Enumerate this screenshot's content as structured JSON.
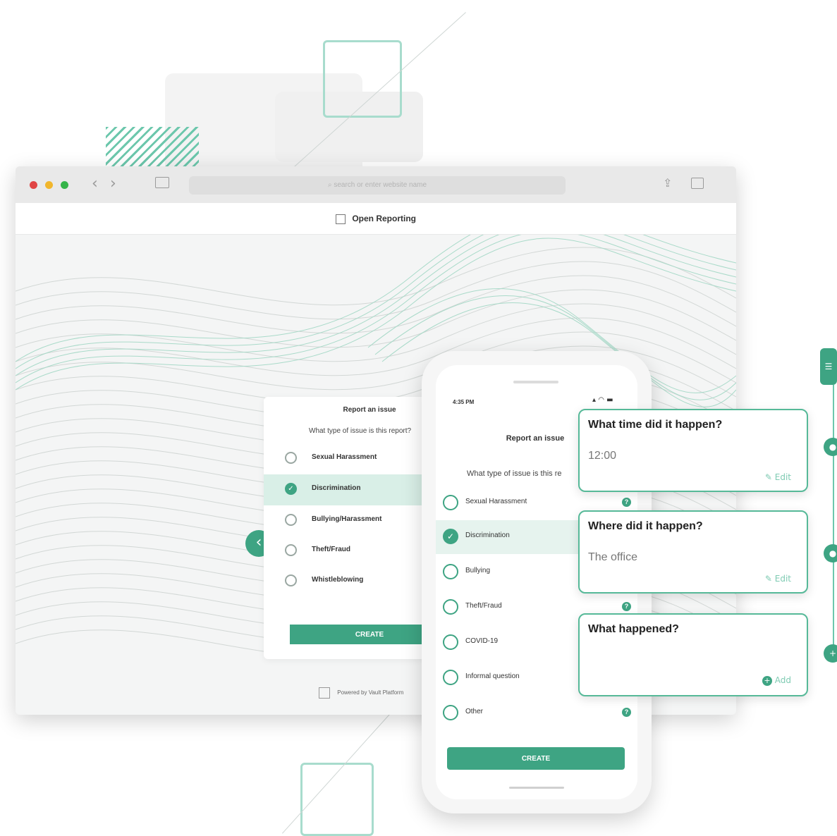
{
  "browser": {
    "address_placeholder": "search or enter website name",
    "page_title": "Open Reporting",
    "back_icon": "chevron-left-icon",
    "footer_text": "Powered by Vault Platform"
  },
  "desktop_form": {
    "title": "Report an issue",
    "question": "What type of issue is this report?",
    "options": [
      {
        "label": "Sexual Harassment",
        "selected": false
      },
      {
        "label": "Discrimination",
        "selected": true
      },
      {
        "label": "Bullying/Harassment",
        "selected": false
      },
      {
        "label": "Theft/Fraud",
        "selected": false
      },
      {
        "label": "Whistleblowing",
        "selected": false
      }
    ],
    "create_label": "CREATE"
  },
  "phone": {
    "status_time": "4:35 PM",
    "status_icons": "signal wifi battery",
    "title": "Report an issue",
    "question": "What type of issue is this re",
    "options": [
      {
        "label": "Sexual Harassment",
        "selected": false,
        "help": true
      },
      {
        "label": "Discrimination",
        "selected": true,
        "help": false
      },
      {
        "label": "Bullying",
        "selected": false,
        "help": false
      },
      {
        "label": "Theft/Fraud",
        "selected": false,
        "help": true
      },
      {
        "label": "COVID-19",
        "selected": false,
        "help": false
      },
      {
        "label": "Informal question",
        "selected": false,
        "help": false
      },
      {
        "label": "Other",
        "selected": false,
        "help": true
      }
    ],
    "create_label": "CREATE"
  },
  "cards": [
    {
      "question": "What time did it happen?",
      "answer": "12:00",
      "action": "Edit"
    },
    {
      "question": "Where did it happen?",
      "answer": "The office",
      "action": "Edit"
    },
    {
      "question": "What happened?",
      "answer": "",
      "action": "Add"
    }
  ],
  "colors": {
    "accent": "#3ea483",
    "accent_light": "#d9efe7",
    "border": "#56b998"
  }
}
